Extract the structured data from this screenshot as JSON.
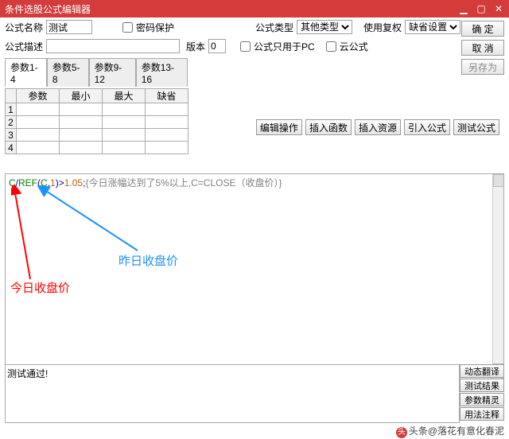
{
  "title": "条件选股公式编辑器",
  "win": {
    "min": "▁",
    "max": "▢",
    "close": "✕"
  },
  "row1": {
    "name_lbl": "公式名称",
    "name_val": "测试",
    "pw_lbl": "密码保护",
    "type_lbl": "公式类型",
    "type_val": "其他类型",
    "fq_lbl": "使用复权",
    "fq_val": "缺省设置"
  },
  "row2": {
    "desc_lbl": "公式描述",
    "ver_lbl": "版本",
    "ver_val": "0",
    "pc_lbl": "公式只用于PC",
    "cloud_lbl": "云公式"
  },
  "btns": {
    "ok": "确  定",
    "cancel": "取  消",
    "saveas": "另存为"
  },
  "tabs": [
    "参数1-4",
    "参数5-8",
    "参数9-12",
    "参数13-16"
  ],
  "ptbl": {
    "h": [
      "参数",
      "最小",
      "最大",
      "缺省"
    ],
    "rows": [
      "1",
      "2",
      "3",
      "4"
    ]
  },
  "toolbar": [
    "编辑操作",
    "插入函数",
    "插入资源",
    "引入公式",
    "测试公式"
  ],
  "code": {
    "a": "C",
    "s1": "/",
    "b": "REF",
    "p1": "(",
    "c": "C",
    "s2": ",",
    "n1": "1",
    "p2": ")",
    "gt": ">",
    "v": "1.05",
    "sc": ";",
    "cm": "{今日涨幅达到了5%以上,C=CLOSE（收盘价）}"
  },
  "ann": {
    "today": "今日收盘价",
    "yest": "昨日收盘价"
  },
  "log": "测试通过!",
  "sbar": [
    "动态翻译",
    "测试结果",
    "参数精灵",
    "用法注释"
  ],
  "wm": "头条@落花有意化春泥"
}
